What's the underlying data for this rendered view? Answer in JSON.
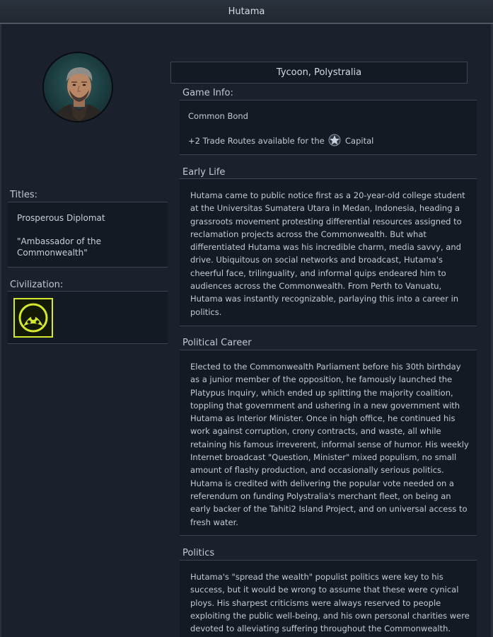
{
  "window": {
    "title": "Hutama"
  },
  "leader": {
    "title_line": "Tycoon, Polystralia"
  },
  "titles": {
    "label": "Titles:",
    "items": [
      "Prosperous Diplomat",
      "\"Ambassador of the Commonwealth\""
    ]
  },
  "civilization": {
    "label": "Civilization:",
    "emblem_color": "#d7e830"
  },
  "game_info": {
    "label": "Game Info:",
    "bonus_name": "Common Bond",
    "bonus_prefix": "+2 Trade Routes available for the",
    "bonus_suffix": "Capital",
    "bonus_icon": "capital-star-icon"
  },
  "sections": [
    {
      "label": "Early Life",
      "text": "Hutama came to public notice first as a 20-year-old college student at the Universitas Sumatera Utara in Medan, Indonesia, heading a grassroots movement protesting differential resources assigned to reclamation projects across the Commonwealth. But what differentiated Hutama was his incredible charm, media savvy, and drive. Ubiquitous on social networks and broadcast, Hutama's cheerful face, trilinguality, and informal quips endeared him to audiences across the Commonwealth. From Perth to Vanuatu, Hutama was instantly recognizable, parlaying this into a career in politics."
    },
    {
      "label": "Political Career",
      "text": "Elected to the Commonwealth Parliament before his 30th birthday as a junior member of the opposition, he famously launched the Platypus Inquiry, which ended up splitting the majority coalition, toppling that government and ushering in a new government with Hutama as Interior Minister. Once in high office, he continued his work against corruption, crony contracts, and waste, all while retaining his famous irreverent, informal sense of humor. His weekly Internet broadcast \"Question, Minister\" mixed populism, no small amount of flashy production, and occasionally serious politics. Hutama is credited with delivering the popular vote needed on a referendum on funding Polystralia's merchant fleet, on being an early backer of the Tahiti2 Island Project, and on universal access to fresh water."
    },
    {
      "label": "Politics",
      "text": "Hutama's \"spread the wealth\" populist politics were key to his success, but it would be wrong to assume that these were cynical ploys. His sharpest criticisms were always reserved to people exploiting the public well-being, and his own personal charities were devoted to alleviating suffering throughout the Commonwealth."
    }
  ]
}
